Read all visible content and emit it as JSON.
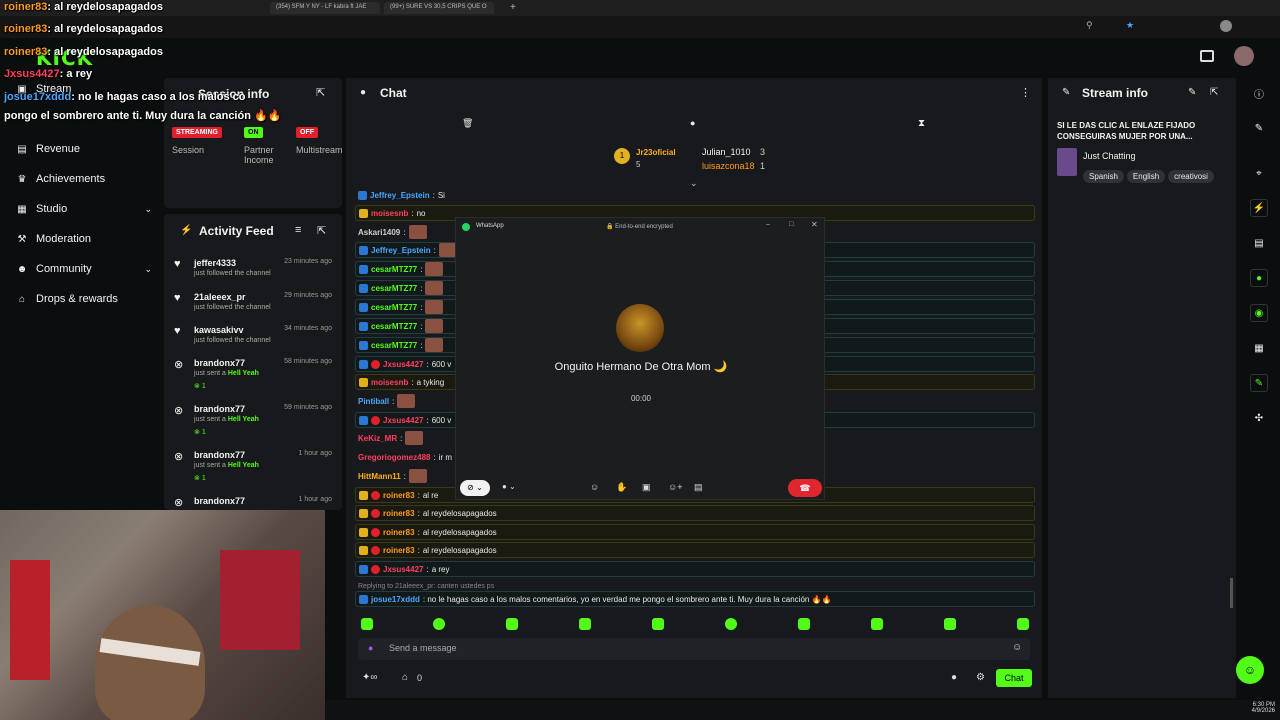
{
  "browser": {
    "tabs": [
      "(354) SFM Y NY - LF kabra ft JAE",
      "(99+) SURE VS 30,5 CRIPS QUE O"
    ]
  },
  "nav": {
    "items": [
      {
        "label": "Stream"
      },
      {
        "label": "Revenue"
      },
      {
        "label": "Achievements"
      },
      {
        "label": "Studio"
      },
      {
        "label": "Moderation"
      },
      {
        "label": "Community"
      },
      {
        "label": "Drops & rewards"
      }
    ]
  },
  "session": {
    "title": "Session info",
    "badges": [
      {
        "text": "STREAMING",
        "label": "Session"
      },
      {
        "text": "ON",
        "label": "Partner Income"
      },
      {
        "text": "OFF",
        "label": "Multistream"
      }
    ]
  },
  "activity": {
    "title": "Activity Feed",
    "items": [
      {
        "name": "jeffer4333",
        "time": "23 minutes ago",
        "desc": "just followed the channel"
      },
      {
        "name": "21aleeex_pr",
        "time": "29 minutes ago",
        "desc": "just followed the channel"
      },
      {
        "name": "kawasakivv",
        "time": "34 minutes ago",
        "desc": "just followed the channel"
      },
      {
        "name": "brandonx77",
        "time": "58 minutes ago",
        "desc": "just sent a",
        "gift": "Hell Yeah",
        "count": "1"
      },
      {
        "name": "brandonx77",
        "time": "59 minutes ago",
        "desc": "just sent a",
        "gift": "Hell Yeah",
        "count": "1"
      },
      {
        "name": "brandonx77",
        "time": "1 hour ago",
        "desc": "just sent a",
        "gift": "Hell Yeah",
        "count": "1"
      },
      {
        "name": "brandonx77",
        "time": "1 hour ago"
      }
    ]
  },
  "chat": {
    "title": "Chat",
    "pinned": {
      "top_user": "Jr23oficial",
      "top_count": "5",
      "second_user": "Julian_1010",
      "second_count": "3",
      "third_user": "luisazcona18",
      "third_count": "1"
    },
    "messages": [
      {
        "user": "Jeffrey_Epstein",
        "sep": ":",
        "text": "Si",
        "color": "#4aa8ff"
      },
      {
        "user": "moisesnb",
        "sep": ":",
        "text": "no",
        "color": "#ff4060"
      },
      {
        "user": "Askari1409",
        "sep": ":",
        "text": "",
        "color": "#cfcfcf"
      },
      {
        "user": "Jeffrey_Epstein",
        "sep": ":",
        "text": "",
        "color": "#4aa8ff"
      },
      {
        "user": "cesarMTZ77",
        "sep": ":",
        "text": "",
        "color": "#53fc18"
      },
      {
        "user": "cesarMTZ77",
        "sep": ":",
        "text": "",
        "color": "#53fc18"
      },
      {
        "user": "cesarMTZ77",
        "sep": ":",
        "text": "",
        "color": "#53fc18"
      },
      {
        "user": "cesarMTZ77",
        "sep": ":",
        "text": "",
        "color": "#53fc18"
      },
      {
        "user": "cesarMTZ77",
        "sep": ":",
        "text": "",
        "color": "#53fc18"
      },
      {
        "user": "Jxsus4427",
        "sep": ":",
        "text": "600 v",
        "color": "#ff4060"
      },
      {
        "user": "moisesnb",
        "sep": ":",
        "text": "a tyking",
        "color": "#ff4060"
      },
      {
        "user": "Pintiball",
        "sep": ":",
        "text": "",
        "color": "#4aa8ff"
      },
      {
        "user": "Jxsus4427",
        "sep": ":",
        "text": "600 v",
        "color": "#ff4060"
      },
      {
        "user": "KeKiz_MR",
        "sep": ":",
        "text": "",
        "color": "#ff4060"
      },
      {
        "user": "Gregoriogomez488",
        "sep": ":",
        "text": "ir m",
        "color": "#ff4060"
      },
      {
        "user": "HittMann11",
        "sep": ":",
        "text": "",
        "color": "#ffb020"
      },
      {
        "user": "roiner83",
        "sep": ":",
        "text": "al re",
        "color": "#ff9a20"
      },
      {
        "user": "roiner83",
        "sep": ":",
        "text": "al reydelosapagados",
        "color": "#ff9a20"
      },
      {
        "user": "roiner83",
        "sep": ":",
        "text": "al reydelosapagados",
        "color": "#ff9a20"
      },
      {
        "user": "roiner83",
        "sep": ":",
        "text": "al reydelosapagados",
        "color": "#ff9a20"
      },
      {
        "user": "Jxsus4427",
        "sep": ":",
        "text": "a rey",
        "color": "#ff4060"
      }
    ],
    "reply_to": "Replying to 21aleeex_pr: canten ustedes ps",
    "last_message": {
      "user": "josue17xddd",
      "text": ": no le hagas caso a los malos comentarios, yo en verdad me pongo el sombrero ante ti. Muy dura la canción 🔥🔥"
    },
    "input_placeholder": "Send a message",
    "footer_count": "0",
    "chat_button": "Chat"
  },
  "whatsapp": {
    "app_title": "WhatsApp",
    "encrypted": "End-to-end encrypted",
    "contact": "Onguito Hermano De Otra Mom 🌙",
    "timer": "00:00"
  },
  "stream_info": {
    "title": "Stream info",
    "stream_title": "SI LE DAS CLIC AL ENLAZE FIJADO CONSEGUIRAS MUJER POR UNA...",
    "category": "Just Chatting",
    "tags": [
      "Spanish",
      "English",
      "creativosi"
    ]
  },
  "overlay": {
    "lines": [
      {
        "user": "roiner83",
        "text": ": al reydelosapagados"
      },
      {
        "user": "roiner83",
        "text": ": al reydelosapagados"
      },
      {
        "user": "roiner83",
        "text": ": al reydelosapagados"
      },
      {
        "user": "Jxsus4427",
        "text": ": a rey"
      },
      {
        "user": "josue17xddd",
        "text": ": no le hagas caso a los malos co"
      },
      {
        "user": "",
        "text": "pongo el sombrero ante ti. Muy dura la canción 🔥🔥"
      }
    ]
  },
  "taskbar": {
    "time": "6:30 PM",
    "date": "4/9/2026"
  },
  "colors": {
    "accent": "#53fc18",
    "panel": "#17191c",
    "bg": "#0b0e0f"
  }
}
